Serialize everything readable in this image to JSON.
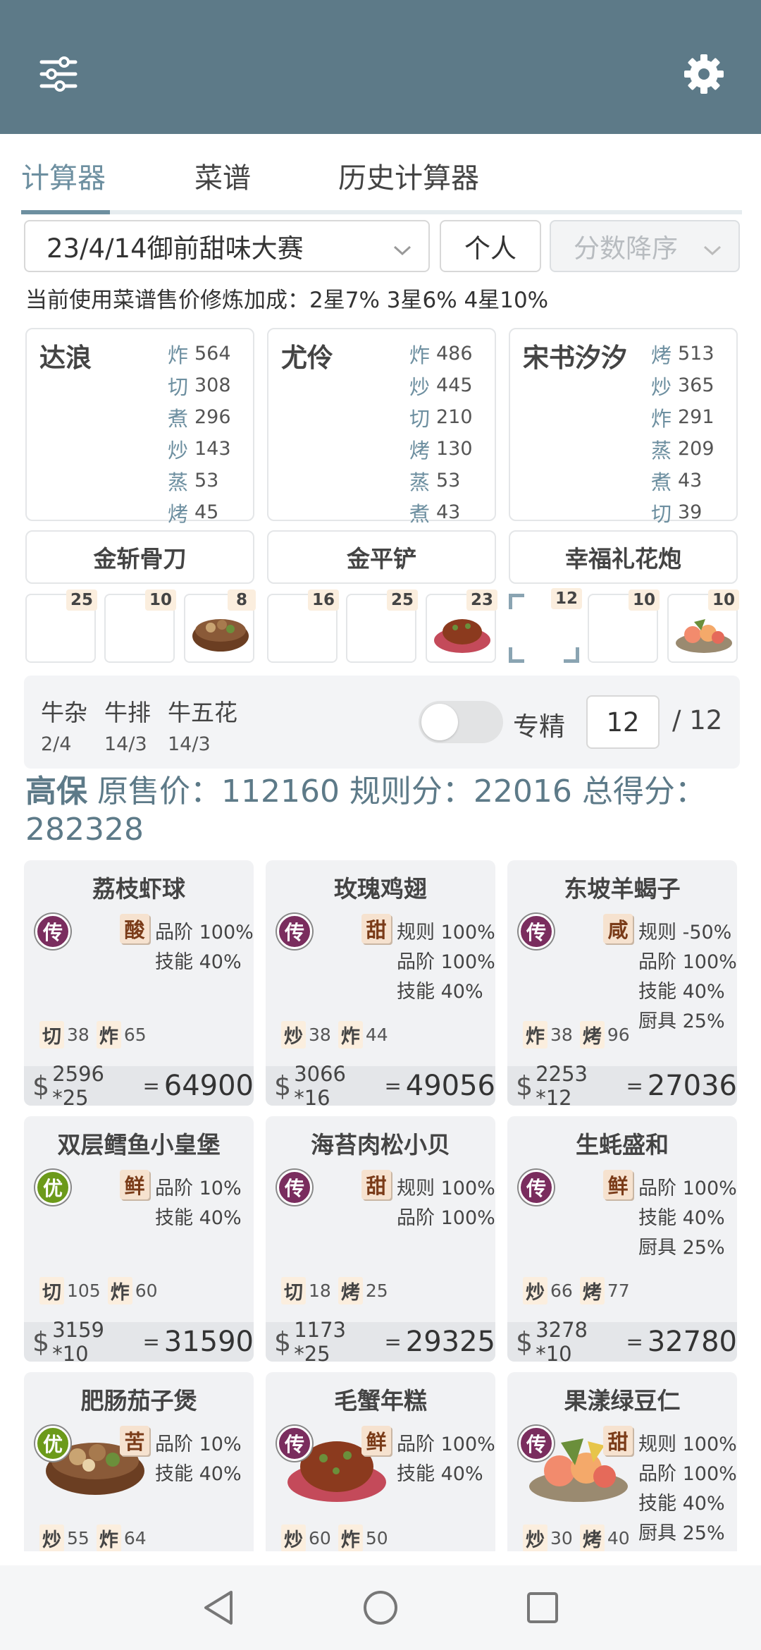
{
  "header": {
    "menu_icon": "sliders-icon",
    "settings_icon": "gear-icon",
    "bg_color": "#5d7a88"
  },
  "tabs": [
    {
      "label": "计算器",
      "active": true
    },
    {
      "label": "菜谱",
      "active": false
    },
    {
      "label": "历史计算器",
      "active": false
    }
  ],
  "controls": {
    "contest": "23/4/14御前甜味大赛",
    "mode": "个人",
    "sort": "分数降序"
  },
  "bonus_text": "当前使用菜谱售价修炼加成：2星7% 3星6% 4星10%",
  "chefs": [
    {
      "name": "达浪",
      "skills": [
        {
          "k": "炸",
          "v": "564"
        },
        {
          "k": "切",
          "v": "308"
        },
        {
          "k": "煮",
          "v": "296"
        },
        {
          "k": "炒",
          "v": "143"
        },
        {
          "k": "蒸",
          "v": "53"
        },
        {
          "k": "烤",
          "v": "45"
        }
      ]
    },
    {
      "name": "尤伶",
      "skills": [
        {
          "k": "炸",
          "v": "486"
        },
        {
          "k": "炒",
          "v": "445"
        },
        {
          "k": "切",
          "v": "210"
        },
        {
          "k": "烤",
          "v": "130"
        },
        {
          "k": "蒸",
          "v": "53"
        },
        {
          "k": "煮",
          "v": "43"
        }
      ]
    },
    {
      "name": "宋书汐汐",
      "skills": [
        {
          "k": "烤",
          "v": "513"
        },
        {
          "k": "炒",
          "v": "365"
        },
        {
          "k": "炸",
          "v": "291"
        },
        {
          "k": "蒸",
          "v": "209"
        },
        {
          "k": "煮",
          "v": "43"
        },
        {
          "k": "切",
          "v": "39"
        }
      ]
    }
  ],
  "tools": [
    "金斩骨刀",
    "金平铲",
    "幸福礼花炮"
  ],
  "slots": [
    "25",
    "10",
    "8",
    "16",
    "25",
    "23",
    "12",
    "10",
    "10"
  ],
  "ingredients": [
    {
      "name": "牛杂",
      "sub": "2/4"
    },
    {
      "name": "牛排",
      "sub": "14/3"
    },
    {
      "name": "牛五花",
      "sub": "14/3"
    }
  ],
  "specialize": {
    "label": "专精",
    "value": "12",
    "total": "/ 12",
    "on": false
  },
  "summary": {
    "guarantee": "高保",
    "text": " 原售价：112160 规则分：22016 总得分：282328"
  },
  "recipes": [
    {
      "title": "荔枝虾球",
      "rarity": "传",
      "flavor": "酸",
      "bonuses": [
        "品阶 100%",
        "技能 40%"
      ],
      "reqs": [
        {
          "k": "切",
          "v": "38"
        },
        {
          "k": "炸",
          "v": "65"
        }
      ],
      "price": "2596 *25",
      "total": "64900"
    },
    {
      "title": "玫瑰鸡翅",
      "rarity": "传",
      "flavor": "甜",
      "bonuses": [
        "规则 100%",
        "品阶 100%",
        "技能 40%"
      ],
      "reqs": [
        {
          "k": "炒",
          "v": "38"
        },
        {
          "k": "炸",
          "v": "44"
        }
      ],
      "price": "3066 *16",
      "total": "49056"
    },
    {
      "title": "东坡羊蝎子",
      "rarity": "传",
      "flavor": "咸",
      "bonuses": [
        "规则 -50%",
        "品阶 100%",
        "技能 40%",
        "厨具 25%"
      ],
      "reqs": [
        {
          "k": "炸",
          "v": "38"
        },
        {
          "k": "烤",
          "v": "96"
        }
      ],
      "price": "2253 *12",
      "total": "27036"
    },
    {
      "title": "双层鳕鱼小皇堡",
      "rarity": "优",
      "flavor": "鲜",
      "bonuses": [
        "品阶 10%",
        "技能 40%"
      ],
      "reqs": [
        {
          "k": "切",
          "v": "105"
        },
        {
          "k": "炸",
          "v": "60"
        }
      ],
      "price": "3159 *10",
      "total": "31590"
    },
    {
      "title": "海苔肉松小贝",
      "rarity": "传",
      "flavor": "甜",
      "bonuses": [
        "规则 100%",
        "品阶 100%"
      ],
      "reqs": [
        {
          "k": "切",
          "v": "18"
        },
        {
          "k": "烤",
          "v": "25"
        }
      ],
      "price": "1173 *25",
      "total": "29325"
    },
    {
      "title": "生蚝盛和",
      "rarity": "传",
      "flavor": "鲜",
      "bonuses": [
        "品阶 100%",
        "技能 40%",
        "厨具 25%"
      ],
      "reqs": [
        {
          "k": "炒",
          "v": "66"
        },
        {
          "k": "烤",
          "v": "77"
        }
      ],
      "price": "3278 *10",
      "total": "32780"
    },
    {
      "title": "肥肠茄子煲",
      "rarity": "优",
      "flavor": "苦",
      "bonuses": [
        "品阶 10%",
        "技能 40%"
      ],
      "reqs": [
        {
          "k": "炒",
          "v": "55"
        },
        {
          "k": "炸",
          "v": "64"
        }
      ],
      "price": "",
      "total": ""
    },
    {
      "title": "毛蟹年糕",
      "rarity": "传",
      "flavor": "鲜",
      "bonuses": [
        "品阶 100%",
        "技能 40%"
      ],
      "reqs": [
        {
          "k": "炒",
          "v": "60"
        },
        {
          "k": "炸",
          "v": "50"
        }
      ],
      "price": "",
      "total": ""
    },
    {
      "title": "果漾绿豆仁",
      "rarity": "传",
      "flavor": "甜",
      "bonuses": [
        "规则 100%",
        "品阶 100%",
        "技能 40%",
        "厨具 25%"
      ],
      "reqs": [
        {
          "k": "炒",
          "v": "30"
        },
        {
          "k": "烤",
          "v": "40"
        }
      ],
      "price": "",
      "total": ""
    }
  ],
  "navbar": {
    "back_icon": "back-triangle-icon",
    "home_icon": "home-circle-icon",
    "recents_icon": "recents-square-icon"
  }
}
